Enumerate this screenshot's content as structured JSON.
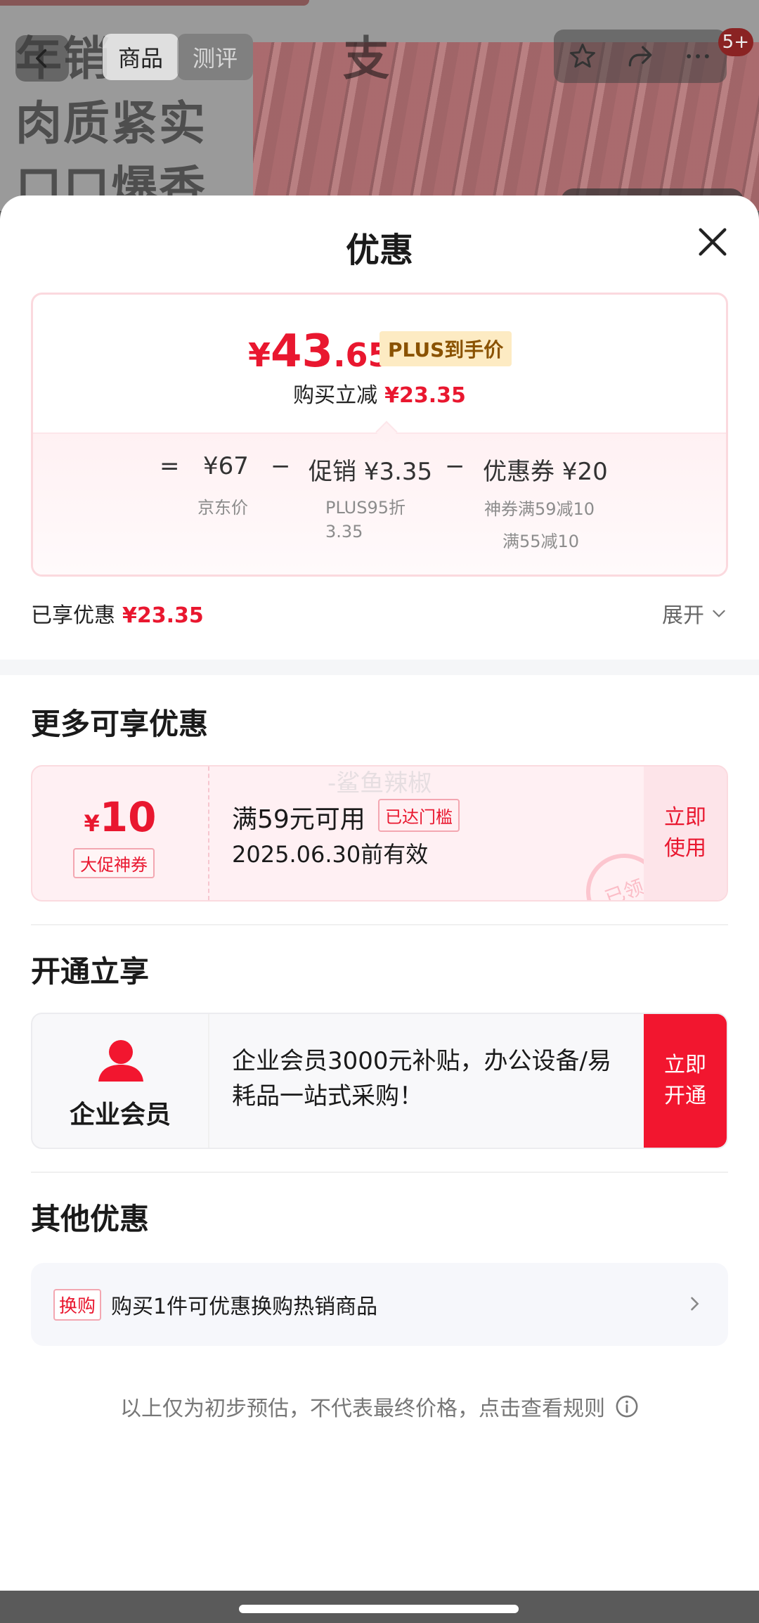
{
  "background": {
    "hero_text": [
      "年销",
      "肉质紧实",
      "口口爆香"
    ],
    "tabs": {
      "goods": "商品",
      "review": "测评",
      "hero_tail": "支"
    },
    "message_badge": "5+",
    "icons": [
      "back-arrow-icon",
      "star-icon",
      "share-icon",
      "more-icon"
    ]
  },
  "sheet": {
    "title": "优惠",
    "price_card": {
      "final_price": {
        "yen": "¥",
        "int": "43",
        "dec": ".65"
      },
      "plus_tag": "PLUS到手价",
      "reduce_label": "购买立减",
      "reduce_amount": "¥23.35",
      "equation": {
        "eq": "=",
        "jd_price": "¥67",
        "minus1": "−",
        "promo": "促销 ¥3.35",
        "minus2": "−",
        "coupon": "优惠券 ¥20"
      },
      "labels": {
        "jd": "京东价",
        "promo_line1": "PLUS95折",
        "promo_line2": "3.35",
        "coupon_line1": "神券满59减10",
        "coupon_line2": "满55减10"
      }
    },
    "enjoyed_label": "已享优惠",
    "enjoyed_amount": "¥23.35",
    "expand_label": "展开",
    "more_section": {
      "title": "更多可享优惠",
      "coupon": {
        "yen": "¥",
        "amount": "10",
        "type": "大促神券",
        "condition": "满59元可用",
        "reach_tag": "已达门槛",
        "valid": "2025.06.30前有效",
        "use_line1": "立即",
        "use_line2": "使用",
        "stamp": "已领",
        "watermark": "-鲨鱼辣椒"
      }
    },
    "open_section": {
      "title": "开通立享",
      "member_name": "企业会员",
      "description": "企业会员3000元补贴，办公设备/易耗品一站式采购！",
      "open_line1": "立即",
      "open_line2": "开通",
      "accent": "#f2162f"
    },
    "other_section": {
      "title": "其他优惠",
      "item_tag": "换购",
      "item_text": "购买1件可优惠换购热销商品"
    },
    "disclaimer": "以上仅为初步预估，不代表最终价格，点击查看规则"
  },
  "colors": {
    "price_red": "#e9172f",
    "plus_gold_bg": "#fdebc3"
  }
}
